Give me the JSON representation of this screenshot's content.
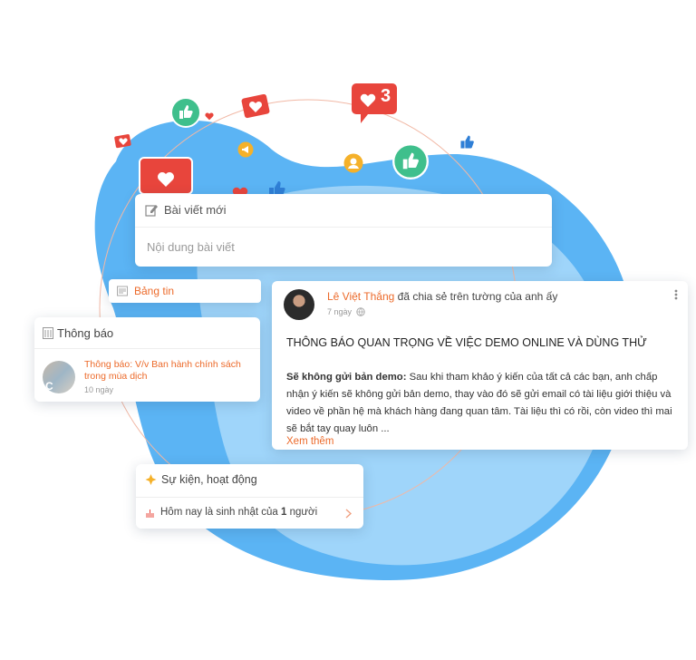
{
  "composer": {
    "title": "Bài viết mới",
    "placeholder": "Nội dung bài viết"
  },
  "newsfeed": {
    "label": "Bảng tin"
  },
  "notifications": {
    "title": "Thông báo",
    "item": {
      "text": "Thông báo: V/v Ban hành chính sách trong mùa dịch",
      "time": "10 ngày",
      "avatar_letter": "C"
    }
  },
  "post": {
    "author": "Lê Việt Thắng",
    "action": "đã chia sẻ trên tường của anh ấy",
    "time": "7 ngày",
    "heading": "THÔNG BÁO QUAN TRỌNG VỀ VIỆC DEMO ONLINE VÀ DÙNG THỬ",
    "bold_lead": "Sẽ không gửi bản demo:",
    "body": " Sau khi tham khảo ý kiến của tất cả các bạn, anh chấp nhận ý kiến sẽ không gửi bản demo, thay vào đó sẽ gửi email có tài liệu giới thiệu và video về phần hệ mà khách hàng đang quan tâm. Tài liệu thì có rồi, còn video thì mai sẽ bắt tay quay luôn  ...",
    "more": "Xem thêm"
  },
  "events": {
    "title": "Sự kiện, hoạt động",
    "item_prefix": "Hôm nay là sinh nhật của ",
    "item_count": "1",
    "item_suffix": " người"
  },
  "badges": {
    "heart_count": "3"
  },
  "colors": {
    "blob": "#5bb4f4",
    "blob_light": "#a6d8fb",
    "accent": "#ec6a2a",
    "like_green": "#3fbf8c",
    "heart_red": "#e8453c"
  }
}
